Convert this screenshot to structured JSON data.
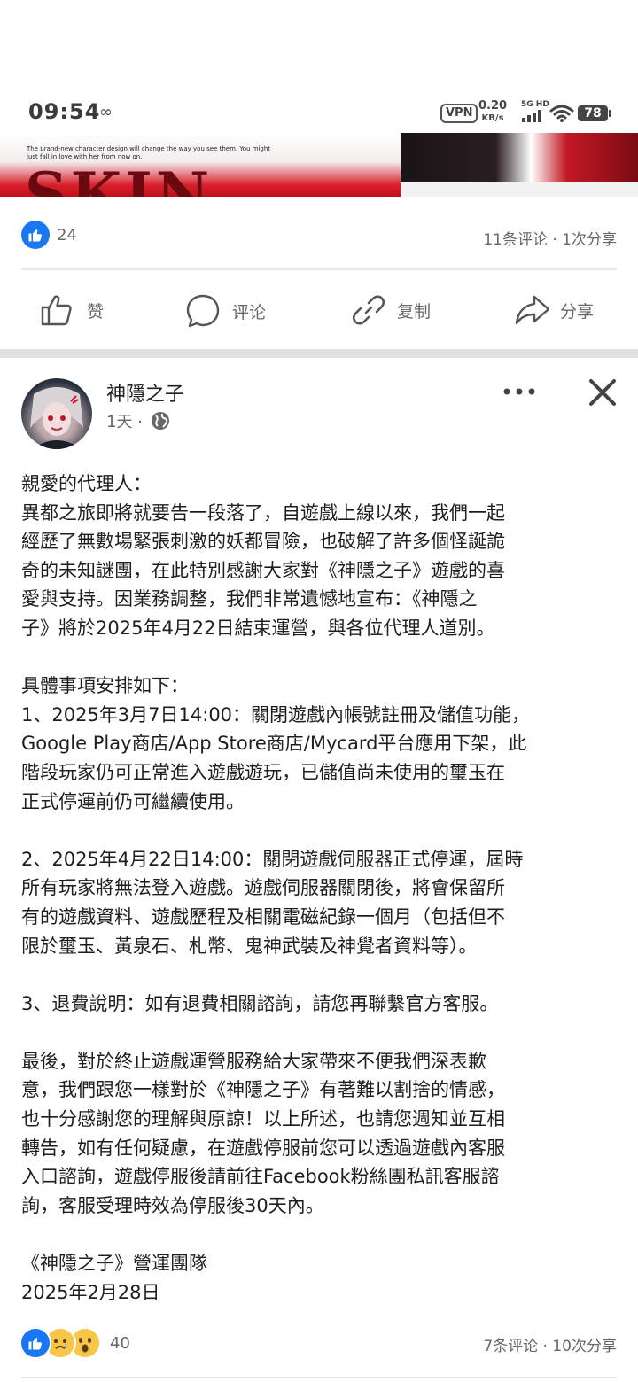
{
  "status_bar": {
    "time": "09:54",
    "infinity_glyph": "∞",
    "vpn": "VPN",
    "net_speed_value": "0.20",
    "net_speed_unit": "KB/s",
    "network_label": "5G HD",
    "battery": "78"
  },
  "banner": {
    "brand_text": "SKIN",
    "tagline": "The brand-new character design will change the way you see them. You might just fall in love with her from now on.",
    "close_glyph": "✕"
  },
  "prev_post": {
    "like_count": "24",
    "comments_shares": "11条评论 · 1次分享"
  },
  "actions": {
    "like": "赞",
    "comment": "评论",
    "copy": "复制",
    "share": "分享"
  },
  "post": {
    "author": "神隱之子",
    "time": "1天 ·",
    "paragraphs": [
      "親愛的代理人：\n異都之旅即將就要告一段落了，自遊戲上線以來，我們一起\n經歷了無數場緊張刺激的妖都冒險，也破解了許多個怪誕詭\n奇的未知謎團，在此特別感謝大家對《神隱之子》遊戲的喜\n愛與支持。因業務調整，我們非常遺憾地宣布：《神隱之\n子》將於2025年4月22日結束運營，與各位代理人道別。",
      "具體事項安排如下：\n1、2025年3月7日14:00：關閉遊戲內帳號註冊及儲值功能，\nGoogle Play商店/App Store商店/Mycard平台應用下架，此\n階段玩家仍可正常進入遊戲遊玩，已儲值尚未使用的璽玉在\n正式停運前仍可繼續使用。",
      "2、2025年4月22日14:00：關閉遊戲伺服器正式停運，屆時\n所有玩家將無法登入遊戲。遊戲伺服器關閉後，將會保留所\n有的遊戲資料、遊戲歷程及相關電磁紀錄一個月（包括但不\n限於璽玉、黃泉石、札幣、鬼神武裝及神覺者資料等）。",
      "3、退費說明：如有退費相關諮詢，請您再聯繫官方客服。",
      "最後，對於終止遊戲運營服務給大家帶來不便我們深表歉\n意，我們跟您一樣對於《神隱之子》有著難以割捨的情感，\n也十分感謝您的理解與原諒！以上所述，也請您週知並互相\n轉告，如有任何疑慮，在遊戲停服前您可以透過遊戲內客服\n入口諮詢，遊戲停服後請前往Facebook粉絲團私訊客服諮\n詢，客服受理時效為停服後30天內。",
      "《神隱之子》營運團隊\n2025年2月28日"
    ],
    "reaction_count": "40",
    "comments_shares": "7条评论 · 10次分享"
  },
  "colors": {
    "facebook_blue": "#1877f2",
    "meta_gray": "#65676b",
    "text": "#1c1e21"
  }
}
